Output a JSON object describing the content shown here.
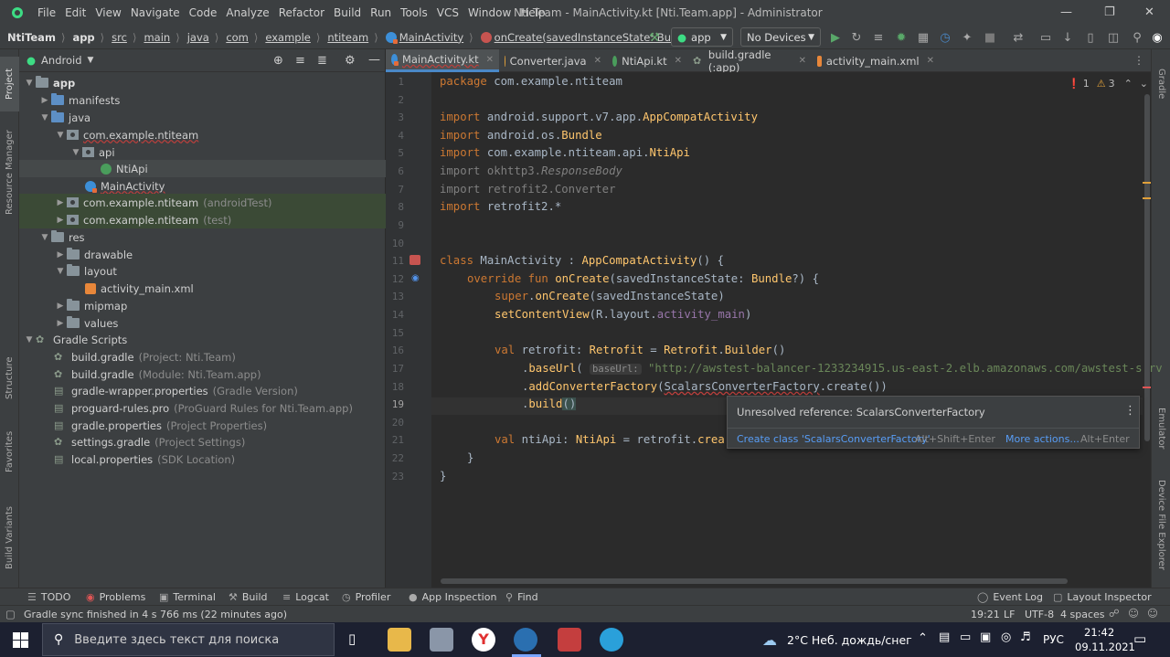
{
  "window": {
    "title": "Nti.Team - MainActivity.kt [Nti.Team.app] - Administrator",
    "menu": [
      "File",
      "Edit",
      "View",
      "Navigate",
      "Code",
      "Analyze",
      "Refactor",
      "Build",
      "Run",
      "Tools",
      "VCS",
      "Window",
      "Help"
    ]
  },
  "breadcrumbs": [
    "NtiTeam",
    "app",
    "src",
    "main",
    "java",
    "com",
    "example",
    "ntiteam",
    "MainActivity",
    "onCreate(savedInstanceState: Bundle?)"
  ],
  "toolbar": {
    "run_config": "app",
    "device": "No Devices"
  },
  "project": {
    "view": "Android",
    "tree": [
      {
        "label": "app",
        "hint": ""
      },
      {
        "label": "manifests",
        "hint": ""
      },
      {
        "label": "java",
        "hint": ""
      },
      {
        "label": "com.example.ntiteam",
        "hint": ""
      },
      {
        "label": "api",
        "hint": ""
      },
      {
        "label": "NtiApi",
        "hint": ""
      },
      {
        "label": "MainActivity",
        "hint": ""
      },
      {
        "label": "com.example.ntiteam",
        "hint": "(androidTest)"
      },
      {
        "label": "com.example.ntiteam",
        "hint": "(test)"
      },
      {
        "label": "res",
        "hint": ""
      },
      {
        "label": "drawable",
        "hint": ""
      },
      {
        "label": "layout",
        "hint": ""
      },
      {
        "label": "activity_main.xml",
        "hint": ""
      },
      {
        "label": "mipmap",
        "hint": ""
      },
      {
        "label": "values",
        "hint": ""
      },
      {
        "label": "Gradle Scripts",
        "hint": ""
      },
      {
        "label": "build.gradle",
        "hint": "(Project: Nti.Team)"
      },
      {
        "label": "build.gradle",
        "hint": "(Module: Nti.Team.app)"
      },
      {
        "label": "gradle-wrapper.properties",
        "hint": "(Gradle Version)"
      },
      {
        "label": "proguard-rules.pro",
        "hint": "(ProGuard Rules for Nti.Team.app)"
      },
      {
        "label": "gradle.properties",
        "hint": "(Project Properties)"
      },
      {
        "label": "settings.gradle",
        "hint": "(Project Settings)"
      },
      {
        "label": "local.properties",
        "hint": "(SDK Location)"
      }
    ]
  },
  "tabs": [
    "MainActivity.kt",
    "Converter.java",
    "NtiApi.kt",
    "build.gradle (:app)",
    "activity_main.xml"
  ],
  "inspections": {
    "errors": "1",
    "warnings": "3"
  },
  "code": {
    "lines": [
      "1",
      "2",
      "3",
      "4",
      "5",
      "6",
      "7",
      "8",
      "9",
      "10",
      "11",
      "12",
      "13",
      "14",
      "15",
      "16",
      "17",
      "18",
      "19",
      "20",
      "21",
      "22",
      "23"
    ]
  },
  "code_text": {
    "l1a": "package",
    "l1b": " com.example.ntiteam",
    "l3a": "import",
    "l3b": " android.support.v7.app.",
    "l3c": "AppCompatActivity",
    "l4a": "import",
    "l4b": " android.os.",
    "l4c": "Bundle",
    "l5a": "import",
    "l5b": " com.example.ntiteam.api.",
    "l5c": "NtiApi",
    "l6a": "import",
    "l6b": " okhttp3.",
    "l6c": "ResponseBody",
    "l7a": "import",
    "l7b": " retrofit2.Converter",
    "l8a": "import",
    "l8b": " retrofit2.*",
    "l11a": "class",
    "l11b": " MainActivity : ",
    "l11c": "AppCompatActivity",
    "l11d": "() {",
    "l12a": "override fun",
    "l12b": " onCreate",
    "l12c": "(savedInstanceState: ",
    "l12d": "Bundle",
    "l12e": "?) {",
    "l13a": "super",
    "l13b": ".",
    "l13c": "onCreate",
    "l13d": "(savedInstanceState)",
    "l14a": "setContentView",
    "l14b": "(R.layout.",
    "l14c": "activity_main",
    "l14d": ")",
    "l16a": "val",
    "l16b": " retrofit: ",
    "l16c": "Retrofit",
    "l16d": " = ",
    "l16e": "Retrofit",
    "l16f": ".",
    "l16g": "Builder",
    "l16h": "()",
    "l17a": ".",
    "l17b": "baseUrl",
    "l17c": "( ",
    "l17hint": "baseUrl:",
    "l17d": " \"http://awstest-balancer-1233234915.us-east-2.elb.amazonaws.com/awstest-serv",
    "l18a": ".",
    "l18b": "addConverterFactory",
    "l18c": "(",
    "l18d": "ScalarsConverterFactory",
    "l18e": ".create())",
    "l19a": ".",
    "l19b": "build",
    "l19c": "()",
    "l21a": "val",
    "l21b": " ntiApi: ",
    "l21c": "NtiApi",
    "l21d": " = retrofit.",
    "l21e": "crea",
    "l22": "}",
    "l23": "}"
  },
  "popup": {
    "message": "Unresolved reference: ScalarsConverterFactory",
    "action1": "Create class 'ScalarsConverterFactory'",
    "shortcut1": "Alt+Shift+Enter",
    "action2": "More actions...",
    "shortcut2": "Alt+Enter"
  },
  "left_tools": [
    "Project",
    "Resource Manager",
    "Structure",
    "Favorites",
    "Build Variants"
  ],
  "right_tools": [
    "Gradle",
    "Emulator",
    "Device File Explorer"
  ],
  "bottom_tools": [
    "TODO",
    "Problems",
    "Terminal",
    "Build",
    "Logcat",
    "Profiler",
    "App Inspection",
    "Find"
  ],
  "bottom_right_tools": [
    "Event Log",
    "Layout Inspector"
  ],
  "status": {
    "message": "Gradle sync finished in 4 s 766 ms (22 minutes ago)",
    "position": "19:21",
    "line_sep": "LF",
    "encoding": "UTF-8",
    "indent": "4 spaces"
  },
  "taskbar": {
    "search_placeholder": "Введите здесь текст для поиска",
    "weather": "2°C  Неб. дождь/снег",
    "lang": "РУС",
    "time": "21:42",
    "date": "09.11.2021"
  }
}
